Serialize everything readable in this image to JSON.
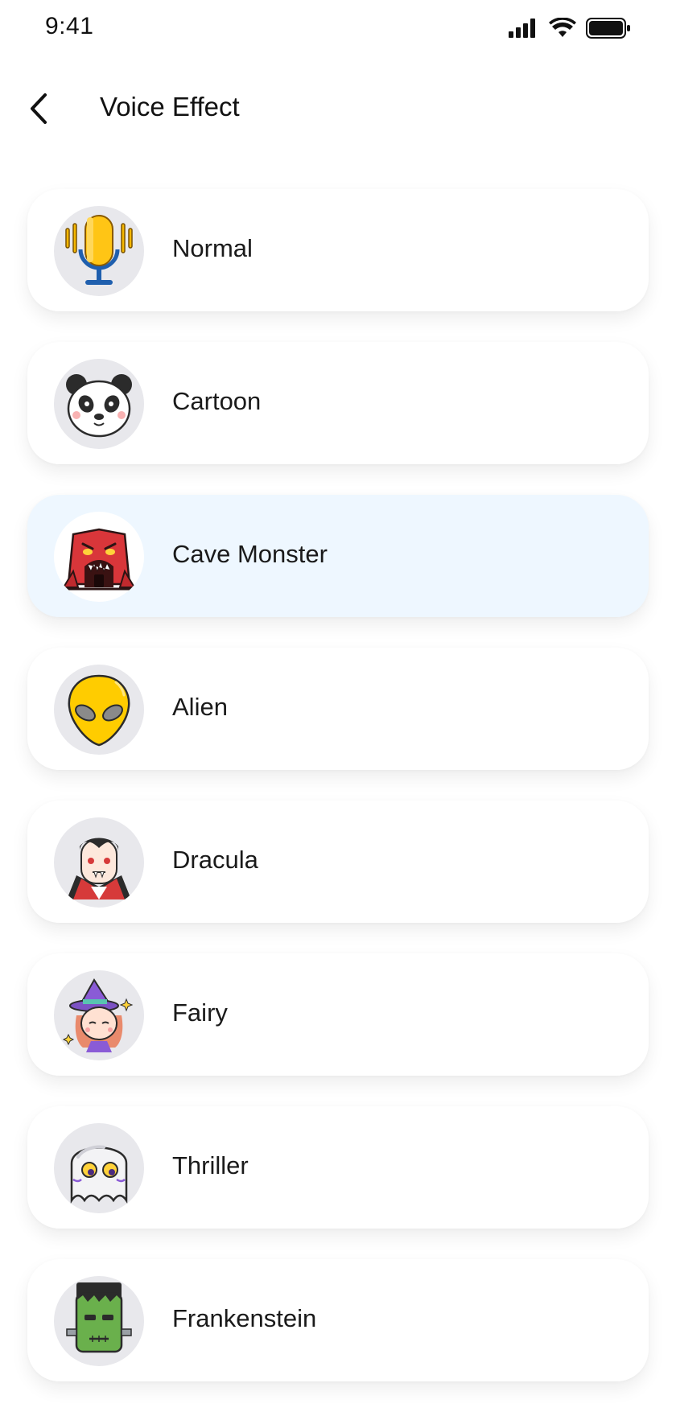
{
  "status_bar": {
    "time": "9:41",
    "icons": [
      "signal-icon",
      "wifi-icon",
      "battery-icon"
    ]
  },
  "header": {
    "back_icon": "chevron-left-icon",
    "title": "Voice Effect"
  },
  "colors": {
    "selected_card_bg": "#eef7ff",
    "card_bg": "#ffffff",
    "avatar_bg": "#e8e8ec"
  },
  "effects": [
    {
      "label": "Normal",
      "icon": "microphone-icon",
      "selected": false
    },
    {
      "label": "Cartoon",
      "icon": "panda-icon",
      "selected": false
    },
    {
      "label": "Cave Monster",
      "icon": "cave-monster-icon",
      "selected": true
    },
    {
      "label": "Alien",
      "icon": "alien-icon",
      "selected": false
    },
    {
      "label": "Dracula",
      "icon": "dracula-icon",
      "selected": false
    },
    {
      "label": "Fairy",
      "icon": "fairy-icon",
      "selected": false
    },
    {
      "label": "Thriller",
      "icon": "ghost-icon",
      "selected": false
    },
    {
      "label": "Frankenstein",
      "icon": "frankenstein-icon",
      "selected": false
    }
  ]
}
